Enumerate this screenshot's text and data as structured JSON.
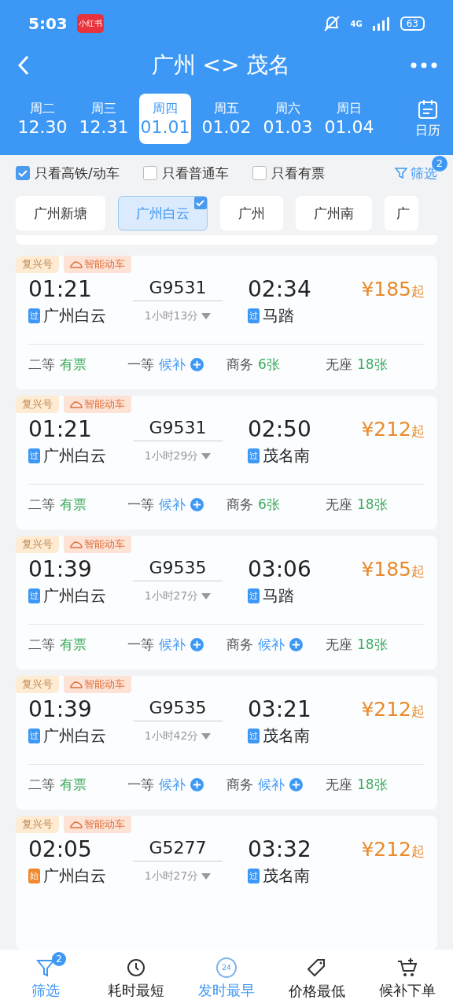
{
  "status_bar": {
    "time": "5:03",
    "app_badge": "小红书",
    "network": "4G",
    "battery": "63"
  },
  "header": {
    "title": "广州 <> 茂名"
  },
  "dates": [
    {
      "weekday": "周二",
      "date": "12.30",
      "selected": false
    },
    {
      "weekday": "周三",
      "date": "12.31",
      "selected": false
    },
    {
      "weekday": "周四",
      "date": "01.01",
      "selected": true
    },
    {
      "weekday": "周五",
      "date": "01.02",
      "selected": false
    },
    {
      "weekday": "周六",
      "date": "01.03",
      "selected": false
    },
    {
      "weekday": "周日",
      "date": "01.04",
      "selected": false
    }
  ],
  "calendar": {
    "label": "日历"
  },
  "filters": [
    {
      "label": "只看高铁/动车",
      "checked": true
    },
    {
      "label": "只看普通车",
      "checked": false
    },
    {
      "label": "只看有票",
      "checked": false
    }
  ],
  "filter_button": {
    "label": "筛选",
    "count": "2"
  },
  "stations": [
    {
      "label": "广州新塘",
      "selected": false
    },
    {
      "label": "广州白云",
      "selected": true
    },
    {
      "label": "广州",
      "selected": false
    },
    {
      "label": "广州南",
      "selected": false
    },
    {
      "label": "广",
      "selected": false
    }
  ],
  "trains": [
    {
      "tags": [
        "复兴号",
        "智能动车"
      ],
      "depart": "01:21",
      "number": "G9531",
      "arrive": "02:34",
      "price": "¥185",
      "price_suffix": "起",
      "from_badge": {
        "kind": "pass",
        "text": "过"
      },
      "from": "广州白云",
      "duration": "1小时13分",
      "to_badge": {
        "kind": "pass",
        "text": "过"
      },
      "to": "马踏",
      "seats": [
        {
          "class": "二等",
          "status": "有票",
          "kind": "available"
        },
        {
          "class": "一等",
          "status": "候补",
          "kind": "waitlist"
        },
        {
          "class": "商务",
          "status": "6张",
          "kind": "available"
        },
        {
          "class": "无座",
          "status": "18张",
          "kind": "available"
        }
      ]
    },
    {
      "tags": [
        "复兴号",
        "智能动车"
      ],
      "depart": "01:21",
      "number": "G9531",
      "arrive": "02:50",
      "price": "¥212",
      "price_suffix": "起",
      "from_badge": {
        "kind": "pass",
        "text": "过"
      },
      "from": "广州白云",
      "duration": "1小时29分",
      "to_badge": {
        "kind": "pass",
        "text": "过"
      },
      "to": "茂名南",
      "seats": [
        {
          "class": "二等",
          "status": "有票",
          "kind": "available"
        },
        {
          "class": "一等",
          "status": "候补",
          "kind": "waitlist"
        },
        {
          "class": "商务",
          "status": "6张",
          "kind": "available"
        },
        {
          "class": "无座",
          "status": "18张",
          "kind": "available"
        }
      ]
    },
    {
      "tags": [
        "复兴号",
        "智能动车"
      ],
      "depart": "01:39",
      "number": "G9535",
      "arrive": "03:06",
      "price": "¥185",
      "price_suffix": "起",
      "from_badge": {
        "kind": "pass",
        "text": "过"
      },
      "from": "广州白云",
      "duration": "1小时27分",
      "to_badge": {
        "kind": "pass",
        "text": "过"
      },
      "to": "马踏",
      "seats": [
        {
          "class": "二等",
          "status": "有票",
          "kind": "available"
        },
        {
          "class": "一等",
          "status": "候补",
          "kind": "waitlist"
        },
        {
          "class": "商务",
          "status": "候补",
          "kind": "waitlist"
        },
        {
          "class": "无座",
          "status": "18张",
          "kind": "available"
        }
      ]
    },
    {
      "tags": [
        "复兴号",
        "智能动车"
      ],
      "depart": "01:39",
      "number": "G9535",
      "arrive": "03:21",
      "price": "¥212",
      "price_suffix": "起",
      "from_badge": {
        "kind": "pass",
        "text": "过"
      },
      "from": "广州白云",
      "duration": "1小时42分",
      "to_badge": {
        "kind": "pass",
        "text": "过"
      },
      "to": "茂名南",
      "seats": [
        {
          "class": "二等",
          "status": "有票",
          "kind": "available"
        },
        {
          "class": "一等",
          "status": "候补",
          "kind": "waitlist"
        },
        {
          "class": "商务",
          "status": "候补",
          "kind": "waitlist"
        },
        {
          "class": "无座",
          "status": "18张",
          "kind": "available"
        }
      ]
    },
    {
      "tags": [
        "复兴号",
        "智能动车"
      ],
      "depart": "02:05",
      "number": "G5277",
      "arrive": "03:32",
      "price": "¥212",
      "price_suffix": "起",
      "from_badge": {
        "kind": "start",
        "text": "始"
      },
      "from": "广州白云",
      "duration": "1小时27分",
      "to_badge": {
        "kind": "pass",
        "text": "过"
      },
      "to": "茂名南"
    }
  ],
  "bottom_nav": [
    {
      "kind": "filter",
      "label": "筛选",
      "badge": "2",
      "selected": true
    },
    {
      "kind": "clock",
      "label": "耗时最短",
      "selected": false
    },
    {
      "kind": "depart",
      "label": "发时最早",
      "icon_text": "24",
      "selected": true
    },
    {
      "kind": "tag",
      "label": "价格最低",
      "selected": false
    },
    {
      "kind": "cart",
      "label": "候补下单",
      "selected": false
    }
  ]
}
